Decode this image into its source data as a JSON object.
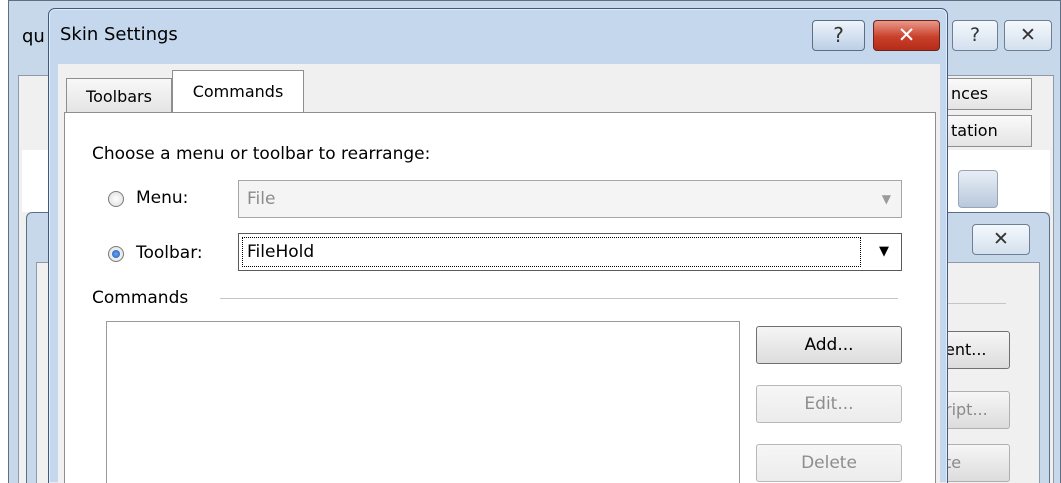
{
  "background_window": {
    "title_fragment": "qu",
    "help_glyph": "?",
    "close_glyph": "✕",
    "tabs": [
      "nces",
      "tation"
    ],
    "dialog2_close_glyph": "✕",
    "buttons": [
      "ent...",
      "ript...",
      "te"
    ]
  },
  "dialog": {
    "title": "Skin Settings",
    "help_glyph": "?",
    "close_glyph": "✕",
    "tabs": [
      {
        "label": "Toolbars",
        "active": false
      },
      {
        "label": "Commands",
        "active": true
      }
    ],
    "prompt": "Choose a menu or toolbar to rearrange:",
    "menu_option": {
      "label": "Menu:",
      "selected": false,
      "value": "File",
      "enabled": false
    },
    "toolbar_option": {
      "label": "Toolbar:",
      "selected": true,
      "value": "FileHold",
      "enabled": true
    },
    "commands_group": "Commands",
    "buttons": {
      "add": "Add...",
      "edit": "Edit...",
      "delete": "Delete"
    }
  },
  "icons": {
    "dropdown": "▼",
    "radio": "radio-icon"
  }
}
